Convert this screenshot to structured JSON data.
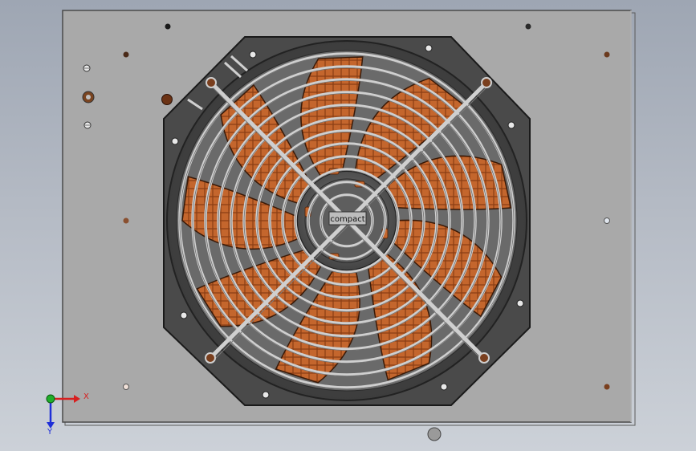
{
  "model": {
    "fan_label": "compact",
    "panel_color": "#a9a9a9",
    "housing_color": "#4a4a4a",
    "blade_color": "#c4662d",
    "grille_color": "#cfcfcf",
    "blade_count": 9,
    "grille_ring_count": 12
  },
  "triad": {
    "x_label": "X",
    "y_label": "Y",
    "x_color": "#d81f1f",
    "y_color": "#1f2fd8",
    "z_color": "#1fae2a"
  }
}
